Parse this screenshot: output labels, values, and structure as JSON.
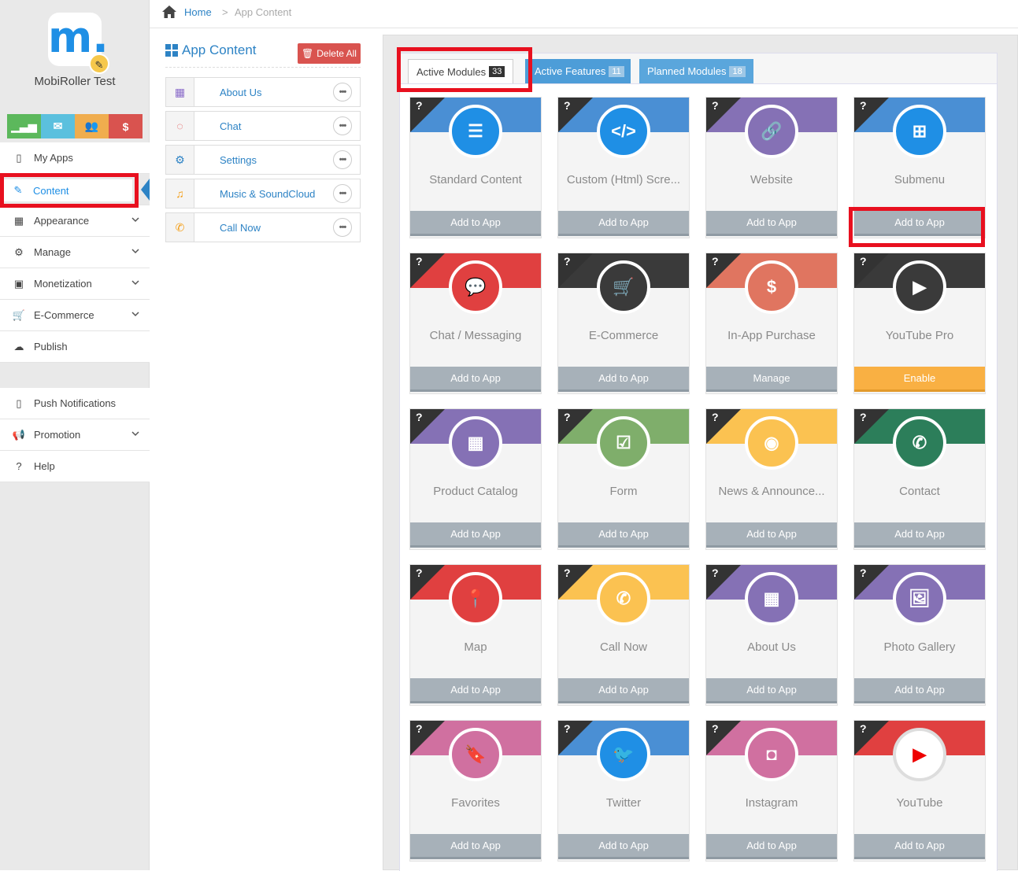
{
  "app": {
    "name": "MobiRoller Test",
    "logo_letter": "m."
  },
  "quick_buttons": [
    {
      "icon": "signal-icon",
      "glyph": "▁▃▅",
      "color": "#5cb85c"
    },
    {
      "icon": "envelope-icon",
      "glyph": "✉",
      "color": "#5bc0de"
    },
    {
      "icon": "users-icon",
      "glyph": "👥",
      "color": "#f0ad4e"
    },
    {
      "icon": "dollar-icon",
      "glyph": "$",
      "color": "#d9534f"
    }
  ],
  "nav": {
    "my_apps": "My Apps",
    "content": "Content",
    "appearance": "Appearance",
    "manage": "Manage",
    "monetization": "Monetization",
    "ecommerce": "E-Commerce",
    "publish": "Publish",
    "push": "Push Notifications",
    "promotion": "Promotion",
    "help": "Help"
  },
  "breadcrumb": {
    "home": "Home",
    "sep": ">",
    "current": "App Content"
  },
  "content_list": {
    "title": "App Content",
    "delete_all": "Delete All",
    "items": [
      {
        "label": "About Us",
        "icon": "building-icon",
        "glyph": "▦",
        "color": "#8a6cc9"
      },
      {
        "label": "Chat",
        "icon": "chat-icon",
        "glyph": "◌",
        "color": "#e04040"
      },
      {
        "label": "Settings",
        "icon": "gear-icon",
        "glyph": "⚙",
        "color": "#2d83c5"
      },
      {
        "label": "Music & SoundCloud",
        "icon": "music-icon",
        "glyph": "♫",
        "color": "#f39c12"
      },
      {
        "label": "Call Now",
        "icon": "phone-icon",
        "glyph": "✆",
        "color": "#f39c12"
      }
    ],
    "more": "•••"
  },
  "tabs": {
    "active": {
      "label": "Active Modules",
      "count": "33"
    },
    "features": {
      "label": "Active Features",
      "count": "11"
    },
    "planned": {
      "label": "Planned Modules",
      "count": "18"
    }
  },
  "modules": [
    {
      "name": "Standard Content",
      "action": "Add to App",
      "band": "#4a8fd4",
      "circle": "#1f8fe5",
      "icon": "list-icon",
      "glyph": "☰"
    },
    {
      "name": "Custom (Html) Scre...",
      "action": "Add to App",
      "band": "#4a8fd4",
      "circle": "#1f8fe5",
      "icon": "code-icon",
      "glyph": "</>"
    },
    {
      "name": "Website",
      "action": "Add to App",
      "band": "#8571b5",
      "circle": "#8571b5",
      "icon": "link-icon",
      "glyph": "🔗"
    },
    {
      "name": "Submenu",
      "action": "Add to App",
      "band": "#4a8fd4",
      "circle": "#1f8fe5",
      "icon": "sitemap-icon",
      "glyph": "⊞"
    },
    {
      "name": "Chat / Messaging",
      "action": "Add to App",
      "band": "#e04040",
      "circle": "#e04040",
      "icon": "chat-icon",
      "glyph": "💬"
    },
    {
      "name": "E-Commerce",
      "action": "Add to App",
      "band": "#3a3a3a",
      "circle": "#3a3a3a",
      "icon": "cart-icon",
      "glyph": "🛒"
    },
    {
      "name": "In-App Purchase",
      "action": "Manage",
      "band": "#e07560",
      "circle": "#e07560",
      "icon": "money-icon",
      "glyph": "$"
    },
    {
      "name": "YouTube Pro",
      "action": "Enable",
      "band": "#3a3a3a",
      "circle": "#3a3a3a",
      "icon": "youtube-pro-icon",
      "glyph": "▶"
    },
    {
      "name": "Product Catalog",
      "action": "Add to App",
      "band": "#8571b5",
      "circle": "#8571b5",
      "icon": "grid-icon",
      "glyph": "▦"
    },
    {
      "name": "Form",
      "action": "Add to App",
      "band": "#7fae6b",
      "circle": "#7fae6b",
      "icon": "checkbox-icon",
      "glyph": "☑"
    },
    {
      "name": "News & Announce...",
      "action": "Add to App",
      "band": "#fbc251",
      "circle": "#fbc251",
      "icon": "rss-icon",
      "glyph": "◉"
    },
    {
      "name": "Contact",
      "action": "Add to App",
      "band": "#2c7e5a",
      "circle": "#2c7e5a",
      "icon": "phone-icon",
      "glyph": "✆"
    },
    {
      "name": "Map",
      "action": "Add to App",
      "band": "#e04040",
      "circle": "#e04040",
      "icon": "map-pin-icon",
      "glyph": "📍"
    },
    {
      "name": "Call Now",
      "action": "Add to App",
      "band": "#fbc251",
      "circle": "#fbc251",
      "icon": "phone-icon",
      "glyph": "✆"
    },
    {
      "name": "About Us",
      "action": "Add to App",
      "band": "#8571b5",
      "circle": "#8571b5",
      "icon": "building-icon",
      "glyph": "▦"
    },
    {
      "name": "Photo Gallery",
      "action": "Add to App",
      "band": "#8571b5",
      "circle": "#8571b5",
      "icon": "image-icon",
      "glyph": "🖼"
    },
    {
      "name": "Favorites",
      "action": "Add to App",
      "band": "#d070a0",
      "circle": "#d070a0",
      "icon": "bookmark-icon",
      "glyph": "🔖"
    },
    {
      "name": "Twitter",
      "action": "Add to App",
      "band": "#4a8fd4",
      "circle": "#1f8fe5",
      "icon": "twitter-icon",
      "glyph": "🐦"
    },
    {
      "name": "Instagram",
      "action": "Add to App",
      "band": "#d070a0",
      "circle": "#d070a0",
      "icon": "instagram-icon",
      "glyph": "◘"
    },
    {
      "name": "YouTube",
      "action": "Add to App",
      "band": "#e04040",
      "circle": "#ffffff",
      "icon": "youtube-icon",
      "glyph": "▶"
    }
  ]
}
